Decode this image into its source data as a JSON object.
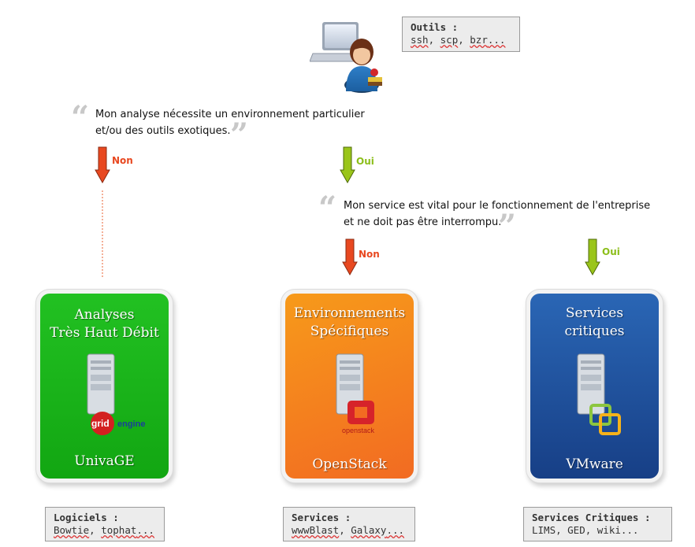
{
  "top_tools": {
    "title": "Outils :",
    "items": [
      "ssh",
      "scp",
      "bzr",
      "..."
    ]
  },
  "question1": {
    "line1": "Mon analyse nécessite un environnement particulier",
    "line2": "et/ou des outils exotiques."
  },
  "question2": {
    "line1": "Mon service est vital pour le fonctionnement de l'entreprise",
    "line2": "et ne doit pas être interrompu."
  },
  "arrows": {
    "a1": {
      "label": "Non",
      "color": "#e84820"
    },
    "a2": {
      "label": "Oui",
      "color": "#9ac51a"
    },
    "a3": {
      "label": "Non",
      "color": "#e84820"
    },
    "a4": {
      "label": "Oui",
      "color": "#9ac51a"
    }
  },
  "cards": [
    {
      "title1": "Analyses",
      "title2": "Très Haut Débit",
      "footer": "UnivaGE",
      "logo_icon": "grid-engine-logo",
      "logo_text1": "grid",
      "logo_text2": "engine",
      "color": "#1db31d"
    },
    {
      "title1": "Environnements",
      "title2": "Spécifiques",
      "footer": "OpenStack",
      "logo_icon": "openstack-logo",
      "logo_text1": "openstack",
      "color": "#f07e1a"
    },
    {
      "title1": "Services",
      "title2": "critiques",
      "footer": "VMware",
      "logo_icon": "vmware-logo",
      "color": "#1e4f96"
    }
  ],
  "bottom_boxes": [
    {
      "title": "Logiciels :",
      "items": [
        "Bowtie",
        "tophat",
        "..."
      ]
    },
    {
      "title": "Services :",
      "items": [
        "wwwBlast",
        "Galaxy",
        "..."
      ]
    },
    {
      "title": "Services Critiques :",
      "text": "LIMS, GED, wiki..."
    }
  ]
}
